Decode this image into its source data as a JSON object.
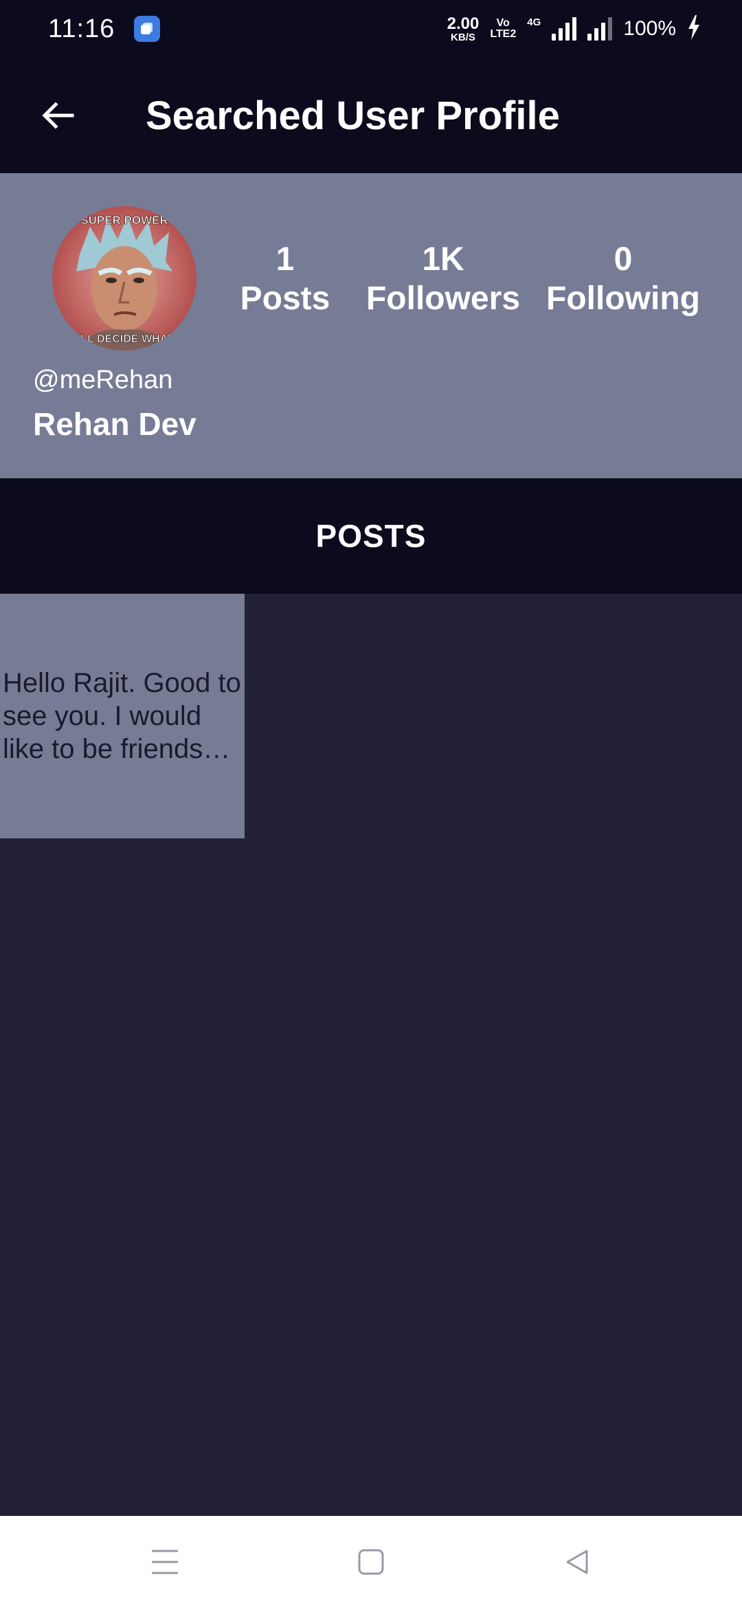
{
  "status_bar": {
    "time": "11:16",
    "net_speed": "2.00",
    "net_speed_unit": "KB/S",
    "volte_top": "Vo",
    "volte_bottom": "LTE2",
    "network_type": "4G",
    "battery": "100%"
  },
  "app_bar": {
    "title": "Searched User Profile"
  },
  "profile": {
    "avatar_top_text": "SUPER POWER",
    "avatar_bottom_text": "I'LL DECIDE WHAT",
    "stats": {
      "posts_count": "1",
      "posts_label": "Posts",
      "followers_count": "1K",
      "followers_label": "Followers",
      "following_count": "0",
      "following_label": "Following"
    },
    "handle": "@meRehan",
    "name": "Rehan Dev"
  },
  "tabs": {
    "posts_label": "POSTS"
  },
  "posts": [
    {
      "text": "Hello Rajit. Good to see you. I would like to be friends with you."
    }
  ],
  "colors": {
    "bar_bg": "#0b0b1d",
    "profile_bg": "#777c96",
    "page_bg": "#222037"
  }
}
